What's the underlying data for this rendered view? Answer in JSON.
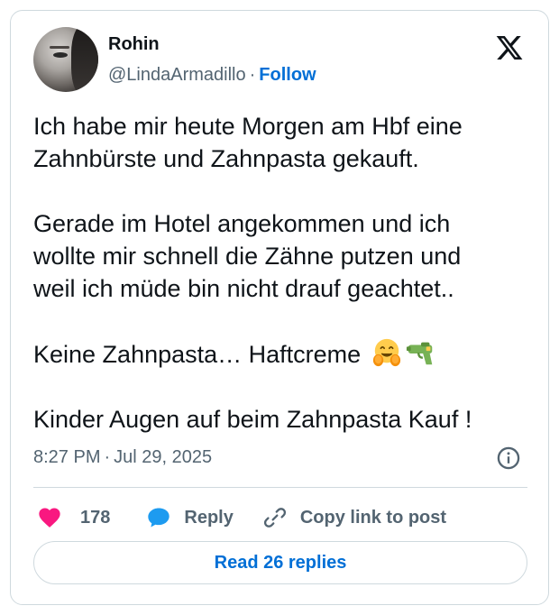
{
  "author": {
    "name": "Rohin",
    "handle": "@LindaArmadillo",
    "follow_label": "Follow"
  },
  "tweet": {
    "paragraph_1_line_1": "Ich habe mir heute Morgen am Hbf eine",
    "paragraph_1_line_2": "Zahnbürste und Zahnpasta gekauft.",
    "paragraph_2_line_1": "Gerade im Hotel angekommen und ich",
    "paragraph_2_line_2": "wollte mir schnell die Zähne putzen und",
    "paragraph_2_line_3": "weil ich müde bin nicht drauf geachtet..",
    "paragraph_3": "Keine Zahnpasta… Haftcreme",
    "paragraph_3_emojis": [
      "hugging-face-emoji",
      "water-pistol-emoji"
    ],
    "paragraph_4": "Kinder Augen auf beim Zahnpasta Kauf !"
  },
  "meta": {
    "time": "8:27 PM",
    "separator": "·",
    "date": "Jul 29, 2025"
  },
  "actions": {
    "like_count": "178",
    "reply_label": "Reply",
    "copy_link_label": "Copy link to post"
  },
  "read_replies_label": "Read 26 replies",
  "colors": {
    "like": "#f91880",
    "reply": "#1d9bf0",
    "link": "#006fd6",
    "secondary_text": "#536471",
    "border": "#cfd9de"
  },
  "icons": {
    "logo": "x-logo-icon",
    "info": "info-icon",
    "like": "heart-icon",
    "reply": "speech-bubble-icon",
    "copy": "link-icon"
  }
}
